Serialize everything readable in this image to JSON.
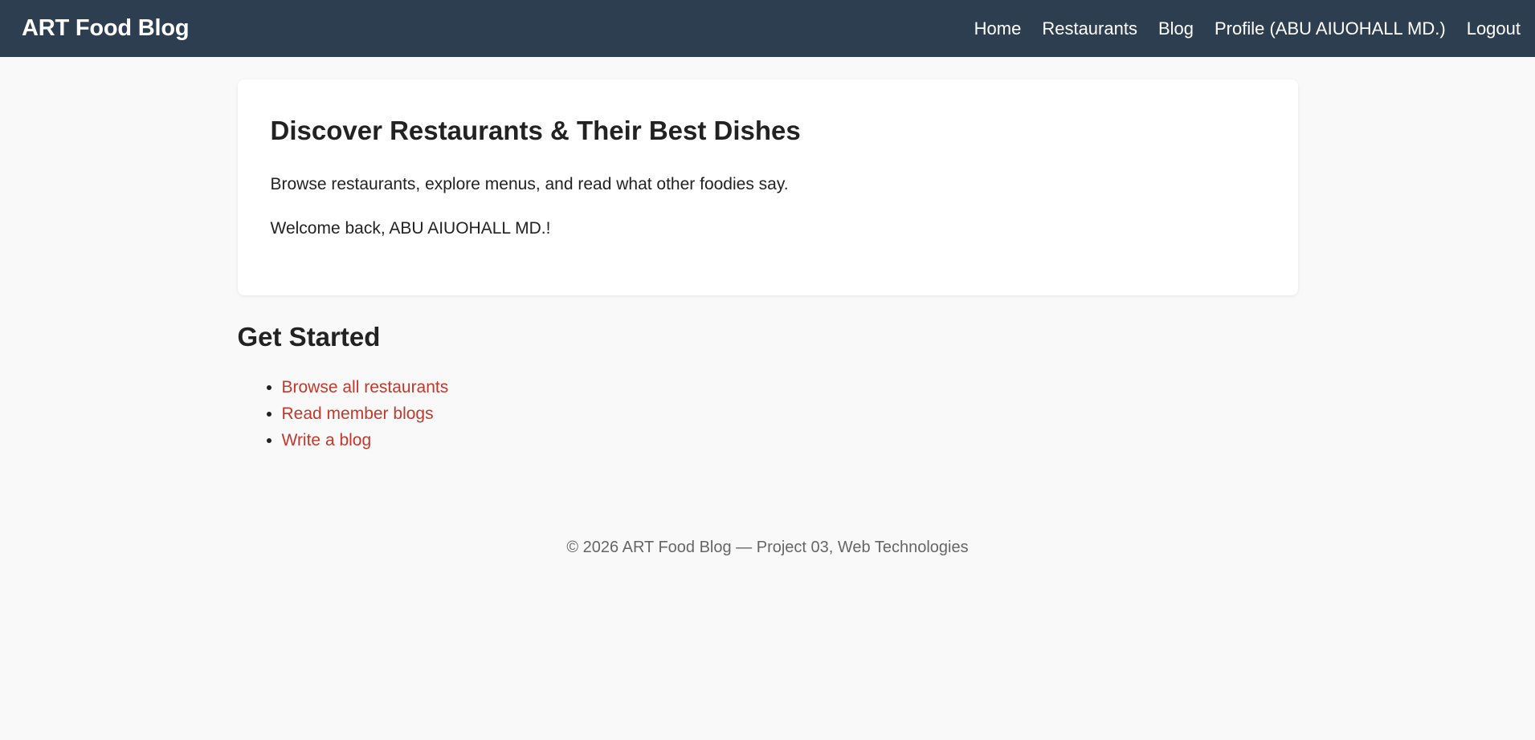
{
  "colors": {
    "nav_bg": "#2c3e50",
    "page_bg": "#f9f9f9",
    "link": "#c0392b",
    "text": "#222222",
    "footer_text": "#666666"
  },
  "navbar": {
    "brand": "ART Food Blog",
    "links": [
      {
        "label": "Home"
      },
      {
        "label": "Restaurants"
      },
      {
        "label": "Blog"
      },
      {
        "label": "Profile (ABU AIUOHALL MD.)"
      },
      {
        "label": "Logout"
      }
    ]
  },
  "hero": {
    "title": "Discover Restaurants & Their Best Dishes",
    "subtitle": "Browse restaurants, explore menus, and read what other foodies say.",
    "welcome": "Welcome back, ABU AIUOHALL MD.!"
  },
  "get_started": {
    "title": "Get Started",
    "links": [
      {
        "label": "Browse all restaurants"
      },
      {
        "label": "Read member blogs"
      },
      {
        "label": "Write a blog"
      }
    ]
  },
  "footer": {
    "text": "© 2026 ART Food Blog — Project 03, Web Technologies"
  }
}
